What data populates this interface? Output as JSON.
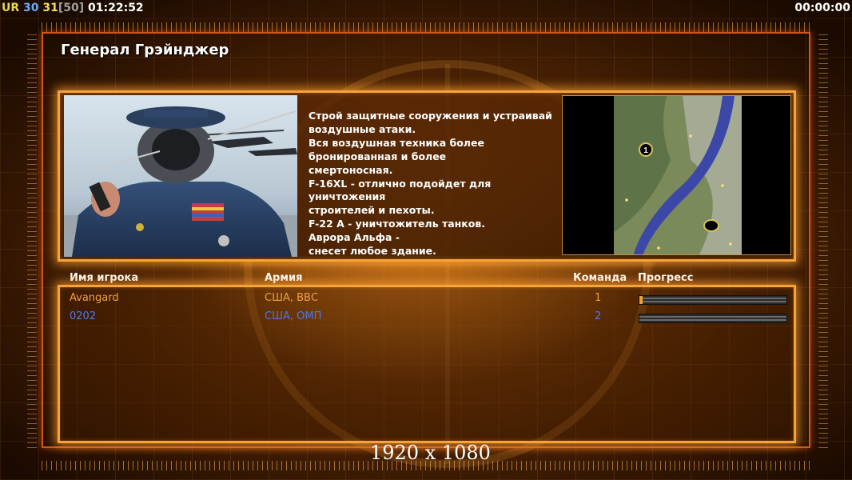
{
  "hud": {
    "faction": "UR",
    "fps_a": "30",
    "fps_b": "31",
    "fps_cap": "[50]",
    "elapsed": "01:22:52",
    "countdown": "00:00:00"
  },
  "general": {
    "name": "Генерал Грэйнджер",
    "description": "Строй защитные сооружения и устраивай\n воздушные атаки.\nВся воздушная техника более\n бронированная и более\nсмертоносная.\nF-16XL - отлично подойдет для уничтожения\n строителей и пехоты.\nF-22 A - уничтожитель танков.\nАврора Альфа -\nснесет любое здание."
  },
  "minimap": {
    "start_marker_label": "1"
  },
  "players_table": {
    "headers": {
      "name": "Имя игрока",
      "army": "Армия",
      "team": "Команда",
      "progress": "Прогресс"
    },
    "rows": [
      {
        "name": "Avangard",
        "army": "США, ВВС",
        "team": "1",
        "progress": 0.02,
        "color": "#f0a040"
      },
      {
        "name": "0202",
        "army": "США, ОМП",
        "team": "2",
        "progress": 0.0,
        "color": "#4a78f0"
      }
    ]
  },
  "resolution_label": "1920 x 1080",
  "colors": {
    "accent": "#f6a43a",
    "frame": "#d0561a"
  }
}
